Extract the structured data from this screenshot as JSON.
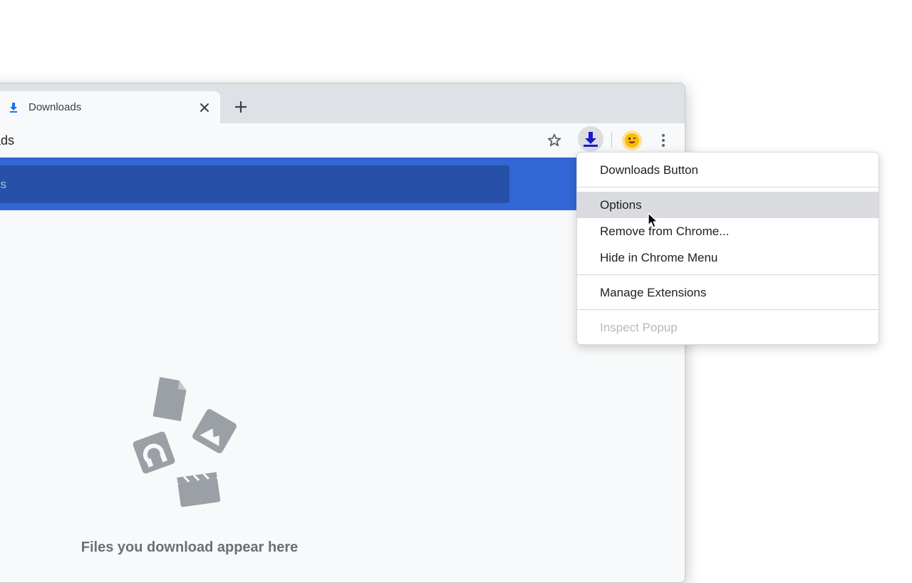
{
  "browser": {
    "tab": {
      "title": "Downloads",
      "icon": "download-icon"
    },
    "new_tab_icon": "plus-icon",
    "omnibox": {
      "text": "ads"
    },
    "toolbar_icons": [
      "star-icon",
      "extension-download-icon",
      "avatar-emoji-icon",
      "more-vert-icon"
    ]
  },
  "downloads_page": {
    "search_text": "ds",
    "empty_message": "Files you download appear here",
    "colors": {
      "header": "#3367d6",
      "search": "#2750a8",
      "illustration": "#9aa0a6"
    }
  },
  "context_menu": {
    "title": "Downloads Button",
    "items": [
      {
        "label": "Options",
        "highlighted": true
      },
      {
        "label": "Remove from Chrome..."
      },
      {
        "label": "Hide in Chrome Menu"
      },
      {
        "label": "Manage Extensions"
      },
      {
        "label": "Inspect Popup",
        "disabled": true
      }
    ]
  }
}
